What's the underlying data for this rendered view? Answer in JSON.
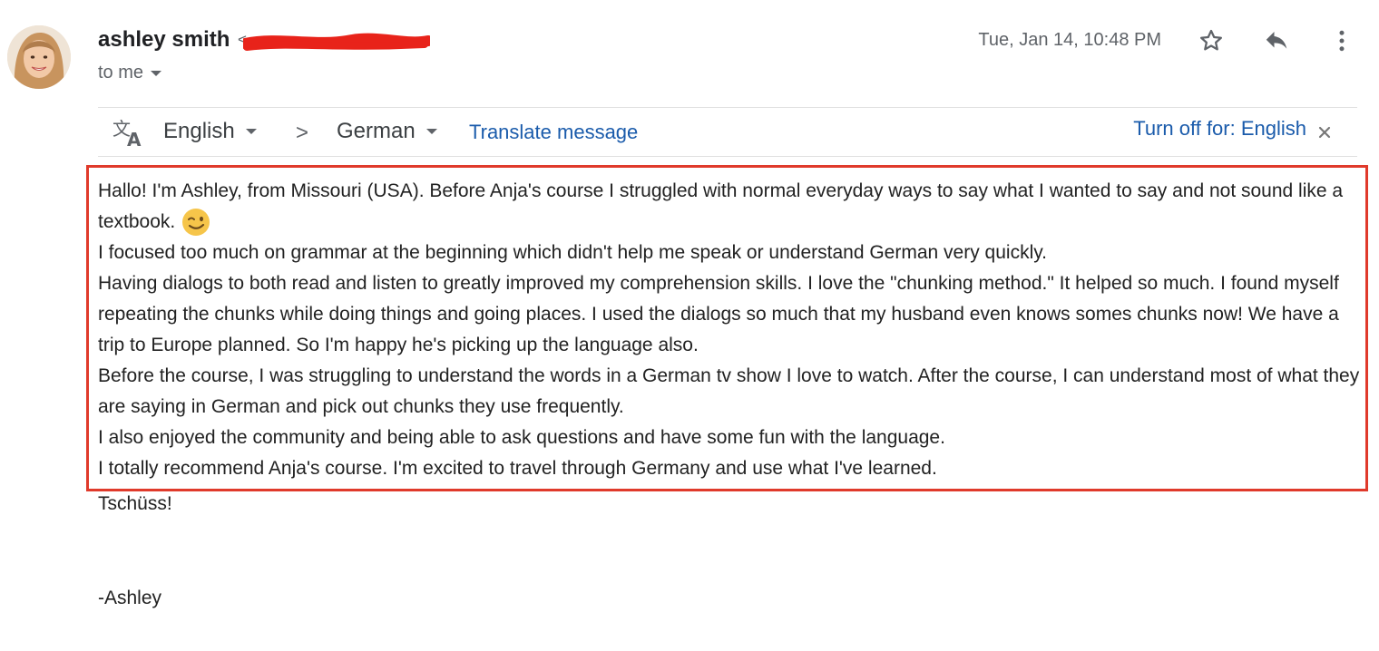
{
  "header": {
    "sender_name": "ashley smith",
    "to_label": "to me",
    "date": "Tue, Jan 14, 10:48 PM"
  },
  "icons": {
    "star": "star-icon",
    "reply": "reply-icon",
    "more": "more-vert-icon",
    "translate": "translate-icon",
    "close": "close-icon"
  },
  "translate_bar": {
    "source_language": "English",
    "separator": ">",
    "target_language": "German",
    "translate_link": "Translate message",
    "turn_off_link": "Turn off for: English"
  },
  "message": {
    "paragraphs": [
      "Hallo! I'm Ashley, from Missouri (USA). Before Anja's course I struggled with normal everyday ways to say what I wanted to say and not sound like a textbook.",
      "I focused too much on grammar at the beginning which didn't help me speak or understand German very quickly.",
      "Having dialogs to both read and listen to greatly improved my comprehension skills. I love the \"chunking method.\" It helped so much. I found myself repeating the chunks while doing things and going places. I used the dialogs so much that my husband even knows somes chunks now! We have a trip to Europe planned. So I'm happy he's picking up the language also.",
      "Before the course, I was struggling to understand the words in a German tv show I love to watch. After the course, I can understand most of what they are saying in German and pick out chunks they use frequently.",
      "I also enjoyed the community and being able to ask questions and have some fun with the language.",
      "I totally recommend Anja's course. I'm excited to travel through Germany and use what I've learned."
    ],
    "emoji": "winking-face",
    "closing": "Tschüss!",
    "signature": "-Ashley"
  },
  "colors": {
    "highlight_border": "#e03a2b",
    "link_blue": "#1a5bab",
    "redaction_red": "#e8231a"
  }
}
